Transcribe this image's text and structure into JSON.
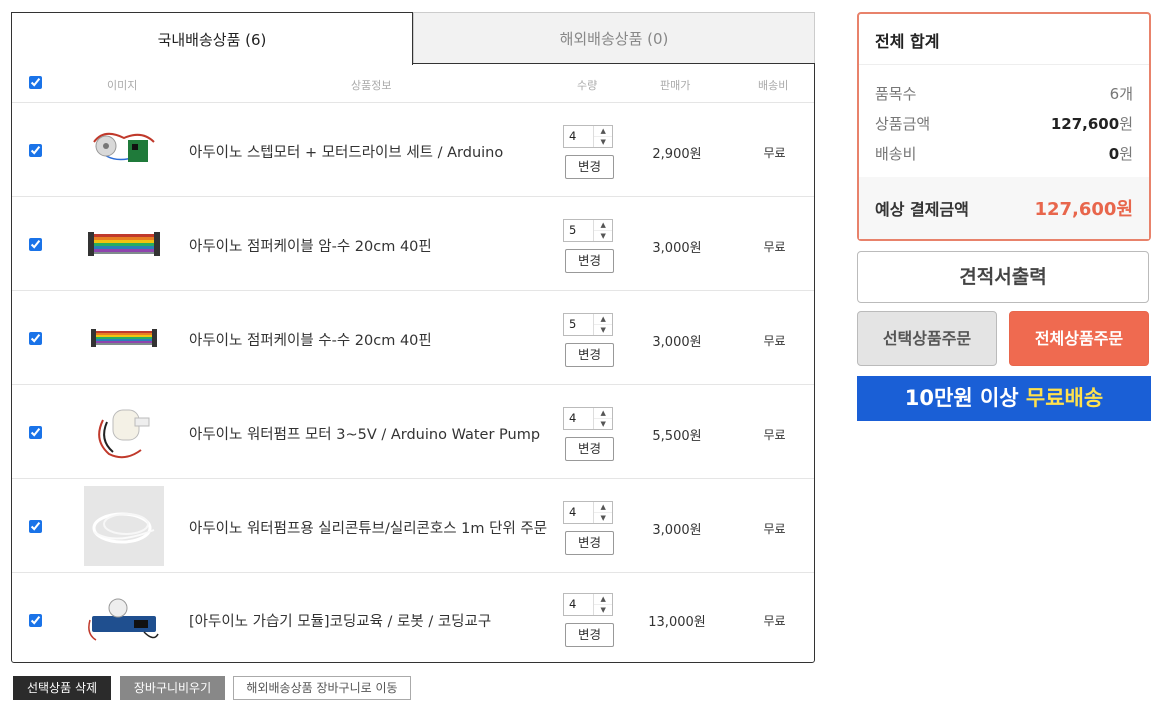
{
  "tabs": {
    "domestic": "국내배송상품 (6)",
    "overseas": "해외배송상품 (0)"
  },
  "table": {
    "headers": {
      "image": "이미지",
      "info": "상품정보",
      "qty": "수량",
      "price": "판매가",
      "shipping": "배송비"
    },
    "change_label": "변경",
    "rows": [
      {
        "name": "아두이노 스텝모터 + 모터드라이브 세트 / Arduino",
        "qty": "4",
        "price": "2,900원",
        "shipping": "무료",
        "thumb_icon": "stepper-motor-icon"
      },
      {
        "name": "아두이노 점퍼케이블 암-수 20cm 40핀",
        "qty": "5",
        "price": "3,000원",
        "shipping": "무료",
        "thumb_icon": "jumper-cable-icon"
      },
      {
        "name": "아두이노 점퍼케이블 수-수 20cm 40핀",
        "qty": "5",
        "price": "3,000원",
        "shipping": "무료",
        "thumb_icon": "jumper-cable-icon"
      },
      {
        "name": "아두이노 워터펌프 모터 3~5V / Arduino Water Pump",
        "qty": "4",
        "price": "5,500원",
        "shipping": "무료",
        "thumb_icon": "water-pump-icon"
      },
      {
        "name": "아두이노 워터펌프용 실리콘튜브/실리콘호스 1m 단위 주문",
        "qty": "4",
        "price": "3,000원",
        "shipping": "무료",
        "thumb_icon": "silicone-tube-icon"
      },
      {
        "name": "[아두이노 가습기 모듈]코딩교육 / 로봇 / 코딩교구",
        "qty": "4",
        "price": "13,000원",
        "shipping": "무료",
        "thumb_icon": "humidifier-module-icon"
      }
    ]
  },
  "actions": {
    "delete_selected": "선택상품 삭제",
    "empty_cart": "장바구니비우기",
    "move_overseas": "해외배송상품 장바구니로 이동"
  },
  "summary": {
    "title": "전체 합계",
    "item_count_label": "품목수",
    "item_count_value": "6개",
    "product_amount_label": "상품금액",
    "product_amount_value": "127,600",
    "product_amount_unit": "원",
    "shipping_label": "배송비",
    "shipping_value": "0",
    "shipping_unit": "원",
    "total_label": "예상 결제금액",
    "total_value": "127,600원"
  },
  "buttons": {
    "quote": "견적서출력",
    "order_selected": "선택상품주문",
    "order_all": "전체상품주문"
  },
  "banner": {
    "prefix": "10만원 이상 ",
    "highlight": "무료배송"
  },
  "colors": {
    "accent": "#ef6a50",
    "banner_bg": "#1a5fd6",
    "banner_highlight": "#ffe14d"
  }
}
